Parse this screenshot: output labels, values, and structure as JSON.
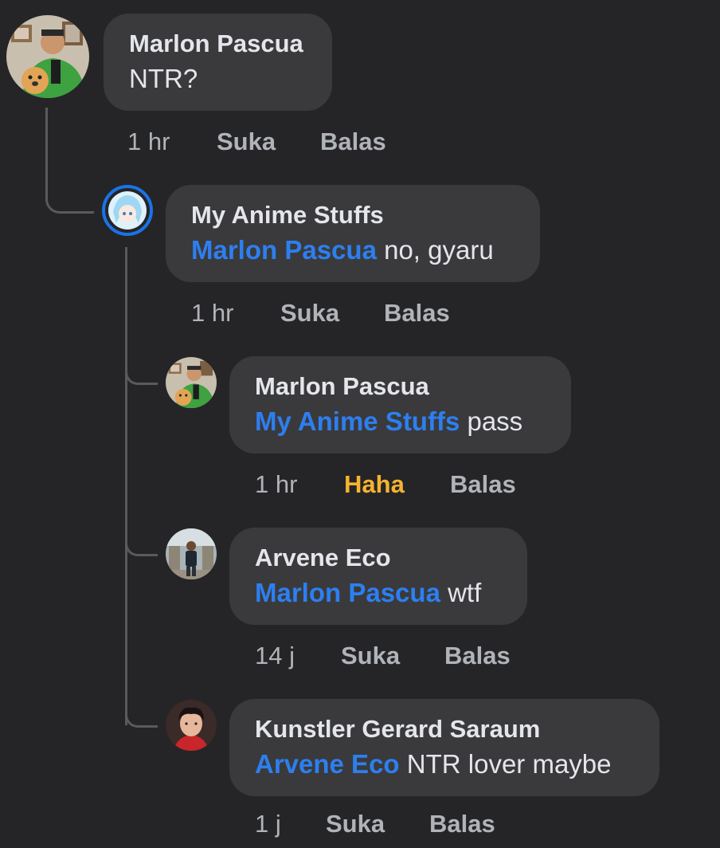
{
  "comments": [
    {
      "author": "Marlon Pascua",
      "mention": "",
      "text": "NTR?",
      "time": "1 hr",
      "like": "Suka",
      "reply": "Balas",
      "avatar_icon": "man-with-dog-avatar"
    },
    {
      "author": "My Anime Stuffs",
      "mention": "Marlon Pascua",
      "text": "no, gyaru",
      "time": "1 hr",
      "like": "Suka",
      "reply": "Balas",
      "avatar_icon": "anime-page-avatar"
    },
    {
      "author": "Marlon Pascua",
      "mention": "My Anime Stuffs",
      "text": "pass",
      "time": "1 hr",
      "like": "Haha",
      "reply": "Balas",
      "avatar_icon": "man-with-dog-avatar"
    },
    {
      "author": "Arvene Eco",
      "mention": "Marlon Pascua",
      "text": "wtf",
      "time": "14 j",
      "like": "Suka",
      "reply": "Balas",
      "avatar_icon": "man-standing-avatar"
    },
    {
      "author": "Kunstler Gerard Saraum",
      "mention": "Arvene Eco",
      "text": "NTR lover maybe",
      "time": "1 j",
      "like": "Suka",
      "reply": "Balas",
      "avatar_icon": "young-man-avatar"
    }
  ],
  "colors": {
    "background": "#252527",
    "bubble": "#3a3a3c",
    "mention": "#2d7ff0",
    "haha": "#f5b331",
    "meta": "#b0b3b8"
  }
}
